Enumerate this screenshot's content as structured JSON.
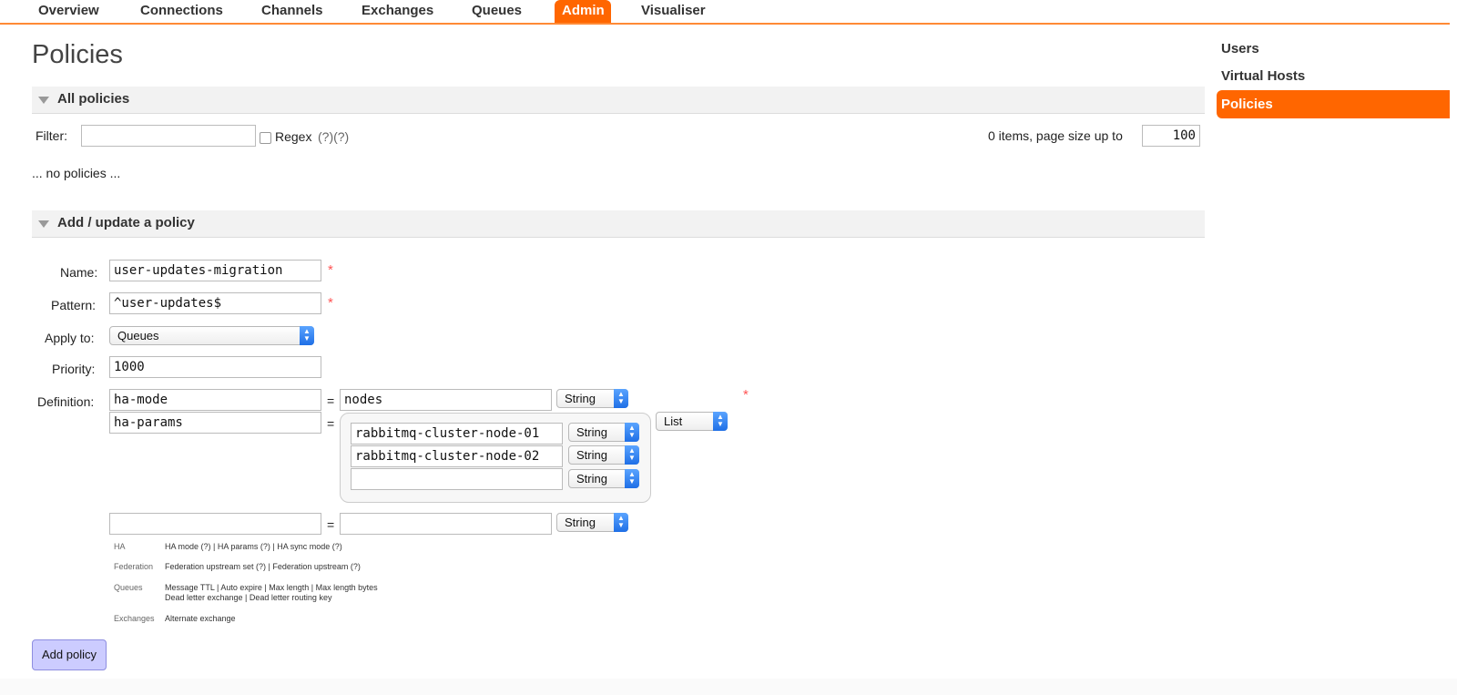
{
  "nav": {
    "tabs": [
      "Overview",
      "Connections",
      "Channels",
      "Exchanges",
      "Queues",
      "Admin",
      "Visualiser"
    ],
    "active": "Admin"
  },
  "page": {
    "title": "Policies"
  },
  "sidebar": {
    "items": [
      "Users",
      "Virtual Hosts",
      "Policies"
    ],
    "active": "Policies"
  },
  "all_policies": {
    "header": "All policies",
    "filter_label": "Filter:",
    "filter_value": "",
    "regex_label": "Regex",
    "regex_help": "(?)(?)",
    "items_text": "0 items, page size up to",
    "page_size": "100",
    "empty_text": "... no policies ..."
  },
  "add_policy": {
    "header": "Add / update a policy",
    "name_label": "Name:",
    "name_value": "user-updates-migration",
    "pattern_label": "Pattern:",
    "pattern_value": "^user-updates$",
    "apply_label": "Apply to:",
    "apply_value": "Queues",
    "priority_label": "Priority:",
    "priority_value": "1000",
    "definition_label": "Definition:",
    "required_mark": "*",
    "equals": "=",
    "def_rows": [
      {
        "key": "ha-mode",
        "value": "nodes",
        "type": "String"
      },
      {
        "key": "ha-params",
        "type": "List",
        "list": [
          {
            "value": "rabbitmq-cluster-node-01",
            "type": "String"
          },
          {
            "value": "rabbitmq-cluster-node-02",
            "type": "String"
          },
          {
            "value": "",
            "type": "String"
          }
        ]
      },
      {
        "key": "",
        "value": "",
        "type": "String"
      }
    ],
    "help": {
      "ha_cat": "HA",
      "ha_links": "HA mode (?) | HA params (?) | HA sync mode (?)",
      "fed_cat": "Federation",
      "fed_links": "Federation upstream set (?) | Federation upstream (?)",
      "queues_cat": "Queues",
      "queues_links_1": "Message TTL | Auto expire | Max length | Max length bytes",
      "queues_links_2": "Dead letter exchange | Dead letter routing key",
      "exch_cat": "Exchanges",
      "exch_links": "Alternate exchange"
    },
    "submit_label": "Add policy"
  },
  "colors": {
    "accent": "#ff6600",
    "button": "#ccccff"
  },
  "icons": {
    "collapse": "triangle-down-icon",
    "select": "select-arrows-icon"
  }
}
